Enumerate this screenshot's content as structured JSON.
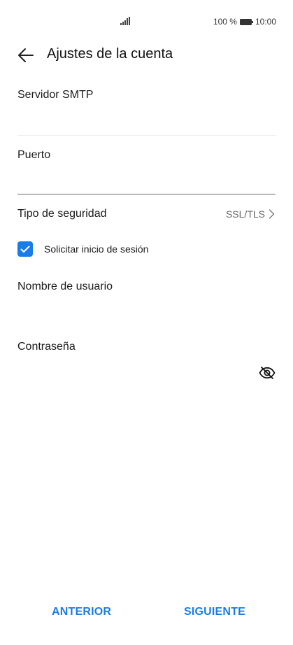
{
  "status_bar": {
    "battery_percent": "100 %",
    "time": "10:00",
    "signal_icon": "signal-icon",
    "battery_icon": "battery-icon"
  },
  "header": {
    "title": "Ajustes de la cuenta",
    "back_icon": "back-arrow-icon"
  },
  "form": {
    "smtp_server": {
      "label": "Servidor SMTP",
      "value": ""
    },
    "port": {
      "label": "Puerto",
      "value": ""
    },
    "security": {
      "label": "Tipo de seguridad",
      "value": "SSL/TLS"
    },
    "require_login": {
      "label": "Solicitar inicio de sesión",
      "checked": true
    },
    "username": {
      "label": "Nombre de usuario",
      "value": ""
    },
    "password": {
      "label": "Contraseña",
      "value": "",
      "visibility_icon": "eye-off-icon"
    }
  },
  "footer": {
    "previous_label": "ANTERIOR",
    "next_label": "SIGUIENTE"
  },
  "colors": {
    "accent": "#1a7ce8",
    "text": "#1a1a1a",
    "secondary_text": "#666666"
  }
}
